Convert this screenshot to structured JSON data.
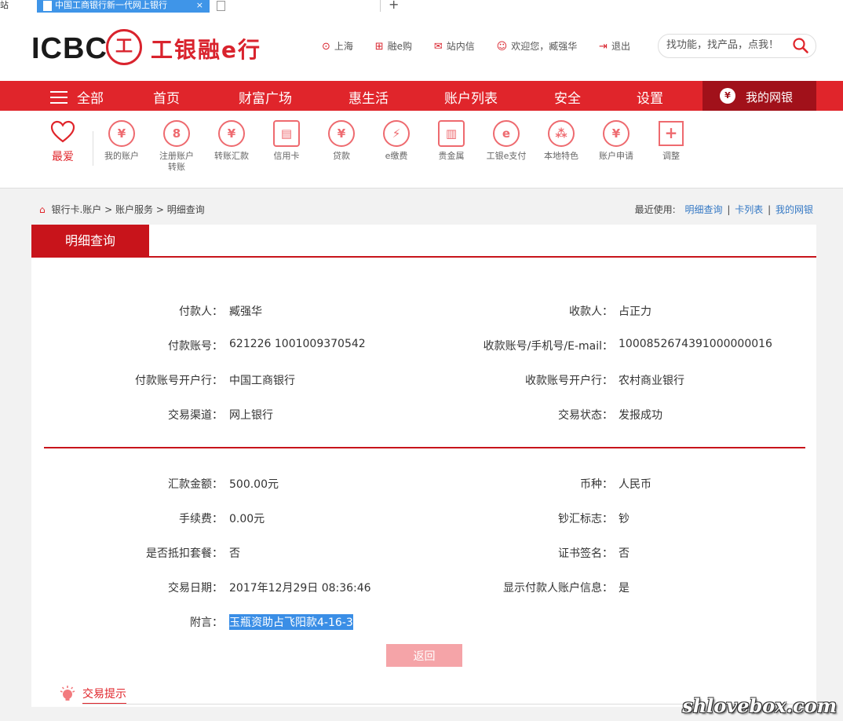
{
  "browser": {
    "left_tab_fragment": "站",
    "active_tab_title": "中国工商银行新一代网上银行",
    "close_glyph": "×",
    "new_tab_glyph": "+"
  },
  "header": {
    "logo_text": "ICBC",
    "logo_seal": "工",
    "logo_cn": "工银融e行",
    "links": [
      {
        "icon": "location-pin-icon",
        "glyph": "⊙",
        "label": "上海"
      },
      {
        "icon": "cart-icon",
        "glyph": "⊞",
        "label": "融e购"
      },
      {
        "icon": "mail-icon",
        "glyph": "✉",
        "label": "站内信"
      },
      {
        "icon": "user-icon",
        "glyph": "☺",
        "label": "欢迎您，臧强华"
      },
      {
        "icon": "logout-icon",
        "glyph": "⇥",
        "label": "退出"
      }
    ],
    "search_placeholder": "找功能，找产品，点我！"
  },
  "nav": {
    "all_label": "全部",
    "items": [
      "首页",
      "财富广场",
      "惠生活",
      "账户列表",
      "安全",
      "设置"
    ],
    "mybank_label": "我的网银",
    "mybank_glyph": "¥"
  },
  "functions": {
    "favorites_label": "最爱",
    "items": [
      {
        "label": "我的账户",
        "glyph": "¥",
        "icon": "my-account-icon"
      },
      {
        "label": "注册账户转账",
        "glyph": "8",
        "icon": "registered-transfer-icon"
      },
      {
        "label": "转账汇款",
        "glyph": "¥",
        "icon": "transfer-icon"
      },
      {
        "label": "信用卡",
        "glyph": "▤",
        "icon": "credit-card-icon"
      },
      {
        "label": "贷款",
        "glyph": "¥",
        "icon": "loan-icon"
      },
      {
        "label": "e缴费",
        "glyph": "⚡",
        "icon": "e-payment-icon"
      },
      {
        "label": "贵金属",
        "glyph": "▥",
        "icon": "precious-metal-icon"
      },
      {
        "label": "工银e支付",
        "glyph": "e",
        "icon": "e-pay-icon"
      },
      {
        "label": "本地特色",
        "glyph": "⁂",
        "icon": "local-feature-icon"
      },
      {
        "label": "账户申请",
        "glyph": "¥",
        "icon": "account-apply-icon"
      },
      {
        "label": "调整",
        "glyph": "+",
        "icon": "adjust-icon"
      }
    ]
  },
  "breadcrumb": {
    "items": [
      "银行卡.账户",
      "账户服务",
      "明细查询"
    ],
    "separator": ">"
  },
  "recent": {
    "label": "最近使用:",
    "links": [
      "明细查询",
      "卡列表",
      "我的网银"
    ],
    "separator": "|"
  },
  "detail": {
    "tab_title": "明细查询",
    "colon": "：",
    "section1": [
      {
        "left_label": "付款人",
        "left_value": "臧强华",
        "right_label": "收款人",
        "right_value": "占正力"
      },
      {
        "left_label": "付款账号",
        "left_value": "621226 1001009370542",
        "right_label": "收款账号/手机号/E-mail",
        "right_value": "1000852674391000000016"
      },
      {
        "left_label": "付款账号开户行",
        "left_value": "中国工商银行",
        "right_label": "收款账号开户行",
        "right_value": "农村商业银行"
      },
      {
        "left_label": "交易渠道",
        "left_value": "网上银行",
        "right_label": "交易状态",
        "right_value": "发报成功"
      }
    ],
    "section2": [
      {
        "left_label": "汇款金额",
        "left_value": "500.00元",
        "right_label": "币种",
        "right_value": "人民币"
      },
      {
        "left_label": "手续费",
        "left_value": "0.00元",
        "right_label": "钞汇标志",
        "right_value": "钞"
      },
      {
        "left_label": "是否抵扣套餐",
        "left_value": "否",
        "right_label": "证书签名",
        "right_value": "否"
      },
      {
        "left_label": "交易日期",
        "left_value": "2017年12月29日 08:36:46",
        "right_label": "显示付款人账户信息",
        "right_value": "是"
      }
    ],
    "remark_label": "附言",
    "remark_value": "玉瓶资助占飞阳款4-16-3",
    "back_button": "返回"
  },
  "tips": {
    "label": "交易提示"
  },
  "watermark": "shlovebox.com",
  "colors": {
    "brand_red": "#e0252b",
    "dark_red": "#c8141b",
    "mybank_bg": "#a1111a",
    "link_blue": "#3478c4",
    "highlight_blue": "#3a8ee6"
  }
}
